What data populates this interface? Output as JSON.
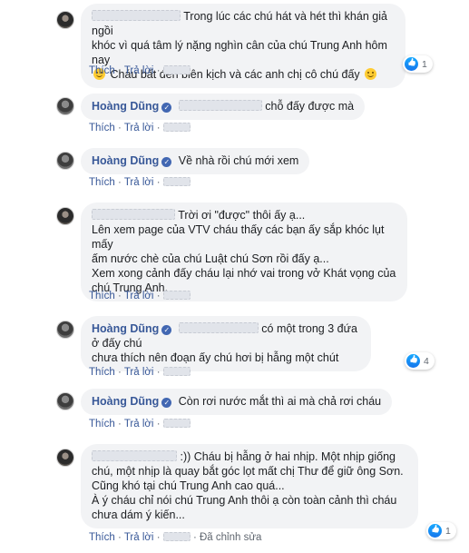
{
  "labels": {
    "like": "Thích",
    "reply": "Trả lời",
    "edited": "Đã chỉnh sửa",
    "dot": "·",
    "verified_mark": "✓"
  },
  "comments": [
    {
      "author": "",
      "lines": [
        "Trong lúc các chú hát và hét thì khán giả ngồi",
        "khóc vì quá tâm lý nặng nghìn cân của chú Trung Anh hôm nay",
        "Cháu bất đền biên kịch và các anh chị cô chú đấy"
      ],
      "reactions": "1"
    },
    {
      "author": "Hoàng Dũng",
      "text": "chỗ đấy được mà"
    },
    {
      "author": "Hoàng Dũng",
      "text": "Về nhà rồi chú mới xem"
    },
    {
      "author": "",
      "lines": [
        "Trời ơi \"được\" thôi ấy ạ...",
        "Lên xem page của VTV cháu thấy các bạn ấy sắp khóc lụt mấy",
        "ấm nước chè của chú Luật chú Sơn rồi đấy ạ...",
        "Xem xong cảnh đấy cháu lại nhớ vai trong vở Khát vọng của",
        "chú Trung Anh."
      ]
    },
    {
      "author": "Hoàng Dũng",
      "lines": [
        "có một trong 3 đứa ở đấy chú",
        "chưa thích nên đoạn ấy chú hơi bị hẫng một chút"
      ],
      "reactions": "4"
    },
    {
      "author": "Hoàng Dũng",
      "text": "Còn rơi nước mắt thì ai mà chả rơi cháu"
    },
    {
      "author": "",
      "lines": [
        ":)) Cháu bị hẫng ở hai nhịp. Một nhịp giống",
        "chú, một nhịp là quay bắt góc lọt mất chị Thư để giữ ông Sơn.",
        "Cũng khó tại chú Trung Anh cao quá...",
        "À ý cháu chỉ nói chú Trung Anh thôi ạ còn toàn cảnh thì cháu",
        "chưa dám ý kiến..."
      ],
      "reactions": "1"
    }
  ]
}
